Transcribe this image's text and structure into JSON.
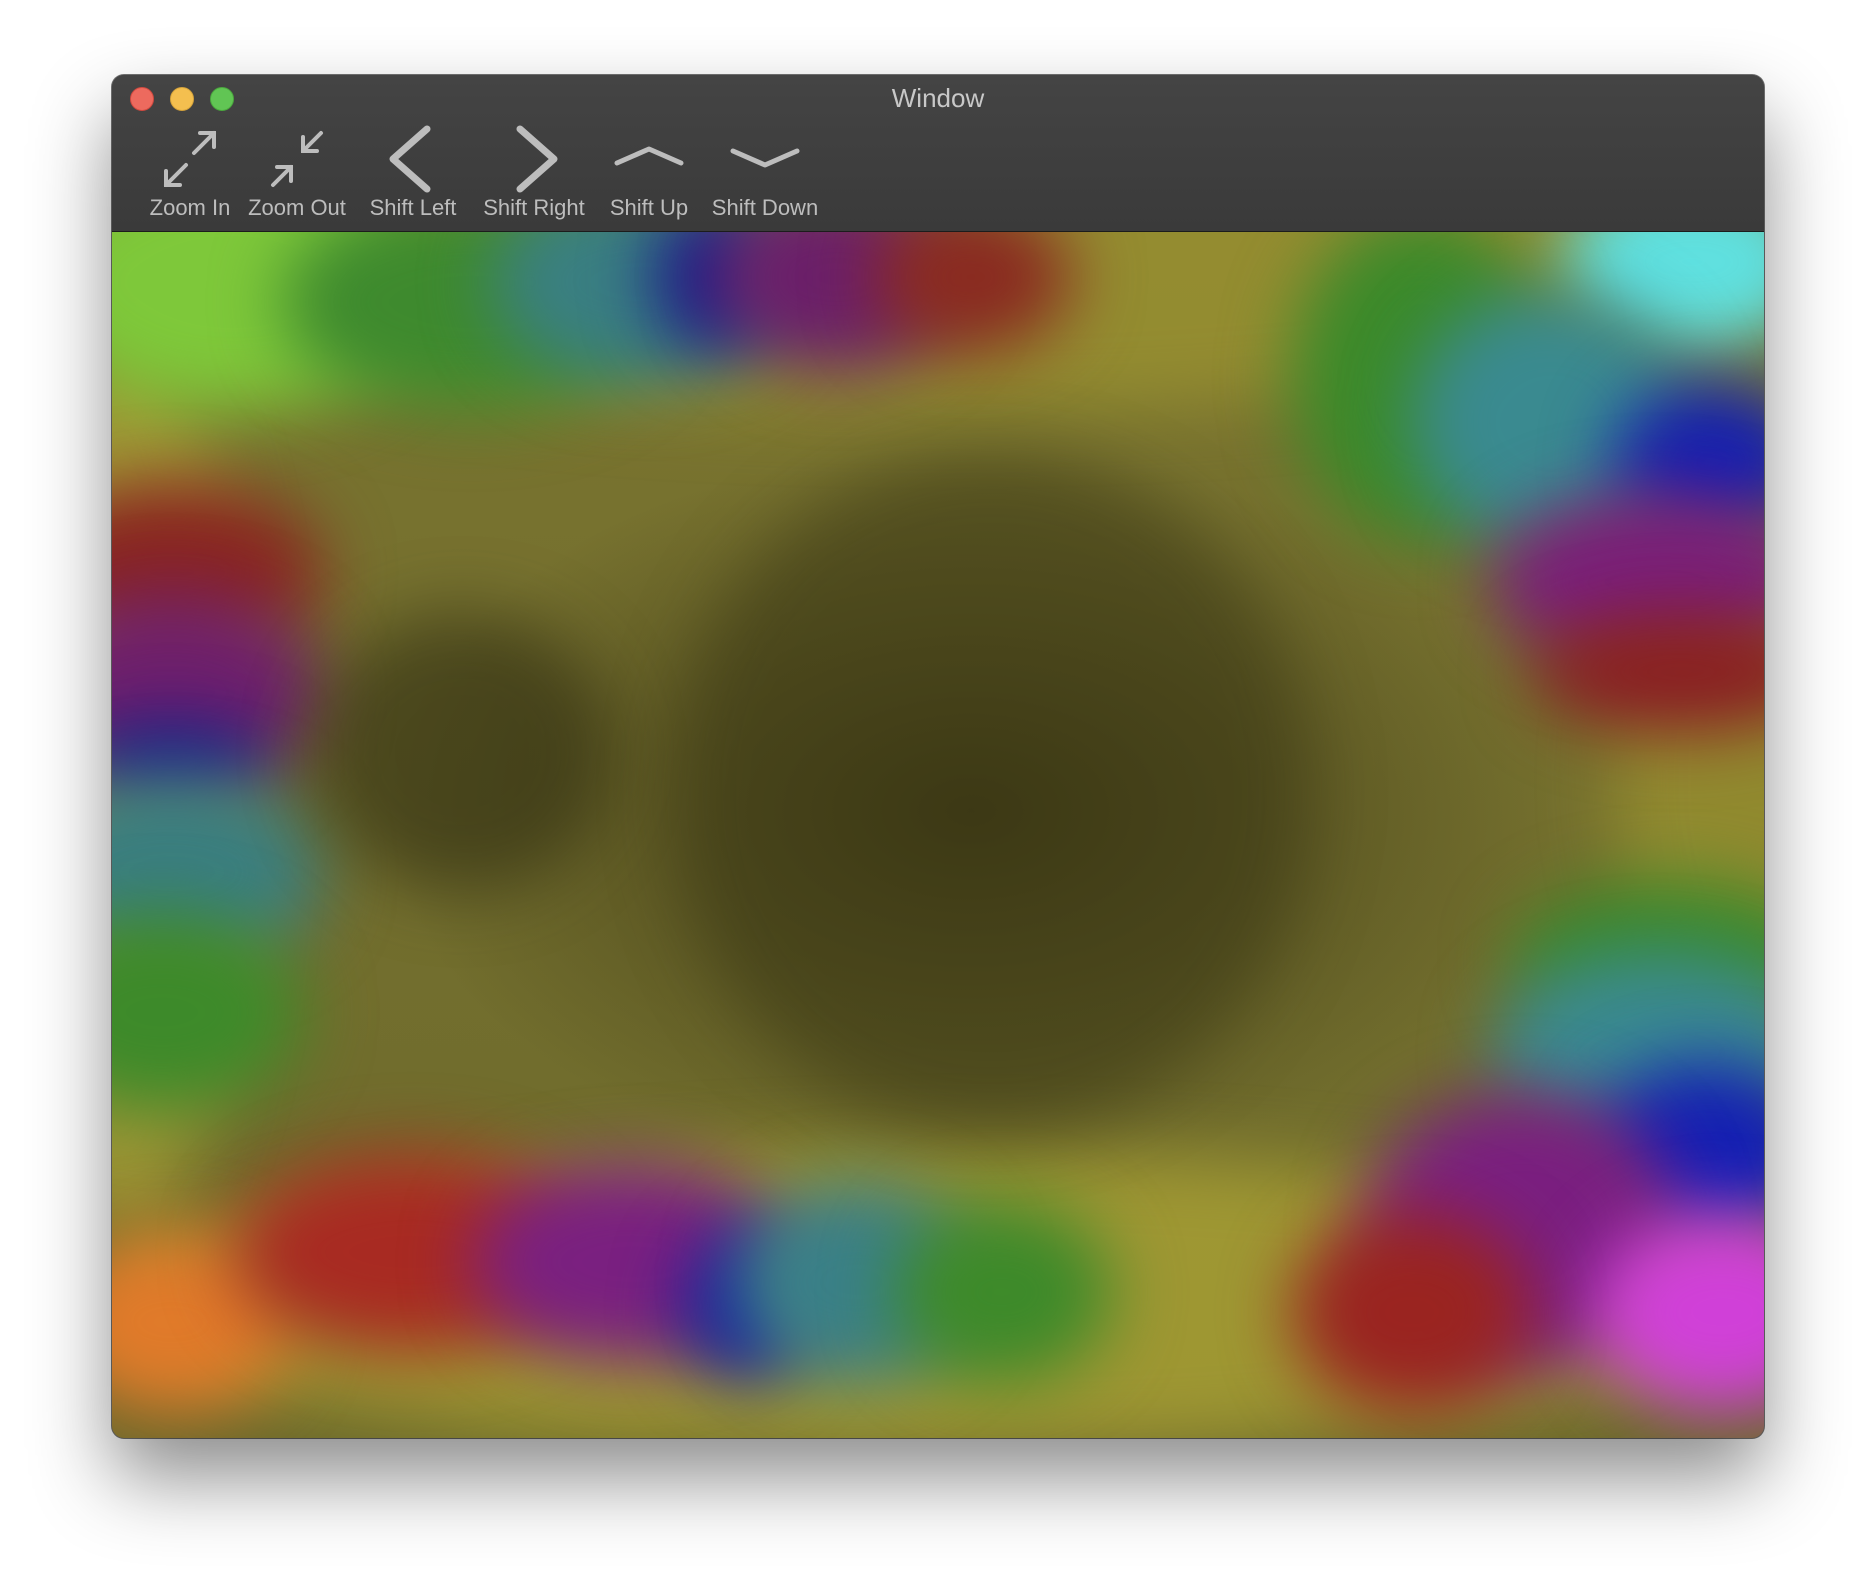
{
  "window": {
    "title": "Window"
  },
  "toolbar": {
    "items": [
      {
        "label": "Zoom In",
        "icon": "zoom-in-icon"
      },
      {
        "label": "Zoom Out",
        "icon": "zoom-out-icon"
      },
      {
        "label": "Shift Left",
        "icon": "chevron-left-icon"
      },
      {
        "label": "Shift Right",
        "icon": "chevron-right-icon"
      },
      {
        "label": "Shift Up",
        "icon": "chevron-up-icon"
      },
      {
        "label": "Shift Down",
        "icon": "chevron-down-icon"
      }
    ]
  },
  "colors": {
    "titlebar": "#3d3d3d",
    "toolbar_text": "#bdbdbd",
    "close": "#ed6a5e",
    "minimize": "#f4bf4f",
    "zoom": "#61c554",
    "field_base": "#6d6a2c"
  }
}
